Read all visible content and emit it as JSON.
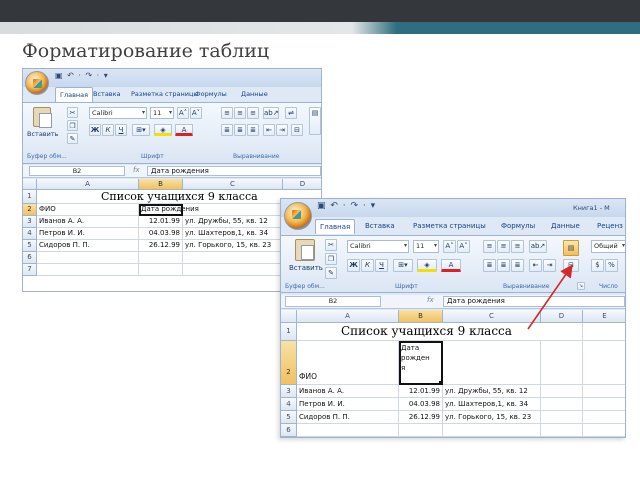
{
  "slide": {
    "title": "Форматирование таблиц"
  },
  "excel": {
    "tabs": [
      "Главная",
      "Вставка",
      "Разметка страницы",
      "Формулы",
      "Данные"
    ],
    "tabs_large": [
      "Главная",
      "Вставка",
      "Разметка страницы",
      "Формулы",
      "Данные",
      "Реценз"
    ],
    "title_right": "Книга1 - M",
    "font_name": "Calibri",
    "font_size": "11",
    "paste_label": "Вставить",
    "groups": {
      "clipboard": "Буфер обм...",
      "font": "Шрифт",
      "alignment": "Выравнивание",
      "number": "Число"
    },
    "number_format": "Общий",
    "name_box": "B2",
    "fx": "fx",
    "formula_value": "Дата рождения",
    "columns_small": [
      "A",
      "B",
      "C",
      "D"
    ],
    "columns_large": [
      "A",
      "B",
      "C",
      "D",
      "E"
    ],
    "table_title": "Список учащихся 9 класса",
    "header_fio": "ФИО",
    "header_date": "Дата рождения",
    "header_date_wrap": [
      "Дата",
      "рожден",
      "я"
    ],
    "rows": [
      {
        "name": "Иванов А. А.",
        "date": "12.01.99",
        "addr": "ул. Дружбы, 55, кв. 12"
      },
      {
        "name": "Петров И. И.",
        "date": "04.03.98",
        "addr": "ул. Шахтеров,1, кв. 34"
      },
      {
        "name": "Сидоров П. П.",
        "date": "26.12.99",
        "addr": "ул. Горького, 15, кв. 23"
      }
    ],
    "row_numbers_small": [
      "1",
      "2",
      "3",
      "4",
      "5",
      "6",
      "7"
    ],
    "row_numbers_large": [
      "1",
      "2",
      "3",
      "4",
      "5",
      "6"
    ]
  },
  "colors": {
    "arrow": "#d62828",
    "accent": "#f1c15f"
  }
}
